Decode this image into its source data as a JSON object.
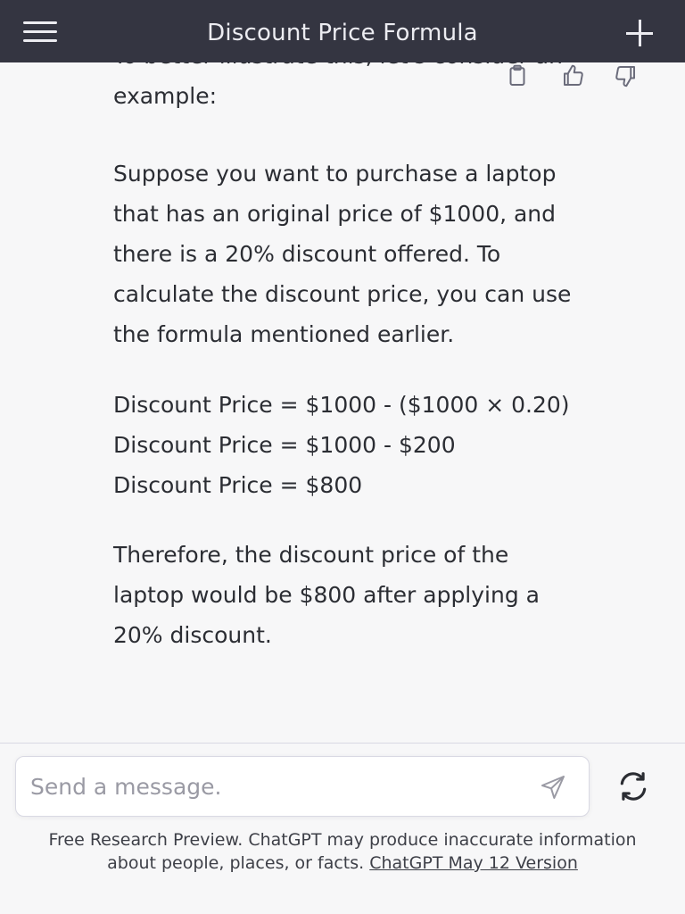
{
  "header": {
    "title": "Discount Price Formula"
  },
  "message": {
    "paragraphs": [
      [
        "To better illustrate this, let's consider an",
        "example:"
      ],
      [
        "Suppose you want to purchase a laptop",
        "that has an original price of $1000, and",
        "there is a 20% discount offered. To",
        "calculate the discount price, you can use",
        "the formula mentioned earlier."
      ],
      [
        "Discount Price = $1000 - ($1000 × 0.20)",
        "Discount Price = $1000 - $200",
        "Discount Price = $800"
      ],
      [
        "Therefore, the discount price of the",
        "laptop would be $800 after applying a",
        "20% discount."
      ]
    ],
    "actions": {
      "copy_icon": "clipboard-icon",
      "like_icon": "thumbs-up-icon",
      "dislike_icon": "thumbs-down-icon"
    }
  },
  "composer": {
    "placeholder": "Send a message.",
    "send_icon": "paper-plane-icon",
    "regenerate_icon": "refresh-icon"
  },
  "footer": {
    "text": "Free Research Preview. ChatGPT may produce inaccurate information about people, places, or facts. ",
    "link": "ChatGPT May 12 Version"
  },
  "colors": {
    "header_bg": "#343541",
    "page_bg": "#f7f7f8",
    "text": "#2b2d33"
  }
}
